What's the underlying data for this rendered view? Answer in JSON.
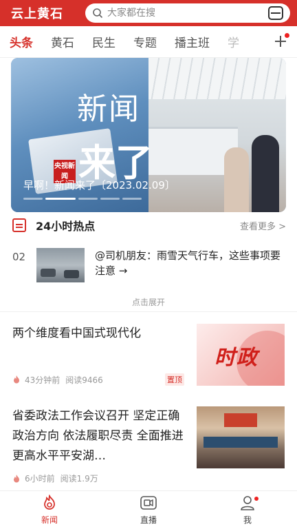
{
  "header": {
    "app_title": "云上黄石",
    "search_placeholder": "大家都在搜"
  },
  "tabs": [
    "头条",
    "黄石",
    "民生",
    "专题",
    "播主班",
    "学"
  ],
  "banner": {
    "big_text_1": "新闻",
    "big_text_2": "来了",
    "logo_text": "央视新闻",
    "caption": "早啊！新闻来了〔2023.02.09〕"
  },
  "hot": {
    "title": "24小时热点",
    "more": "查看更多 >",
    "items": [
      {
        "rank": "02",
        "text": "@司机朋友：雨雪天气行车，这些事项要注意 →"
      }
    ],
    "expand": "点击展开"
  },
  "news": [
    {
      "title": "两个维度看中国式现代化",
      "time": "43分钟前",
      "reads": "阅读9466",
      "badge": "置顶",
      "thumb_text": "时政"
    },
    {
      "title": "省委政法工作会议召开 坚定正确政治方向 依法履职尽责 全面推进更高水平平安湖…",
      "time": "6小时前",
      "reads": "阅读1.9万"
    }
  ],
  "bottom_nav": [
    {
      "label": "新闻",
      "icon": "news-flame-icon",
      "active": true
    },
    {
      "label": "直播",
      "icon": "video-camera-icon",
      "active": false
    },
    {
      "label": "我",
      "icon": "user-icon",
      "active": false
    }
  ],
  "colors": {
    "brand": "#d6302a"
  }
}
